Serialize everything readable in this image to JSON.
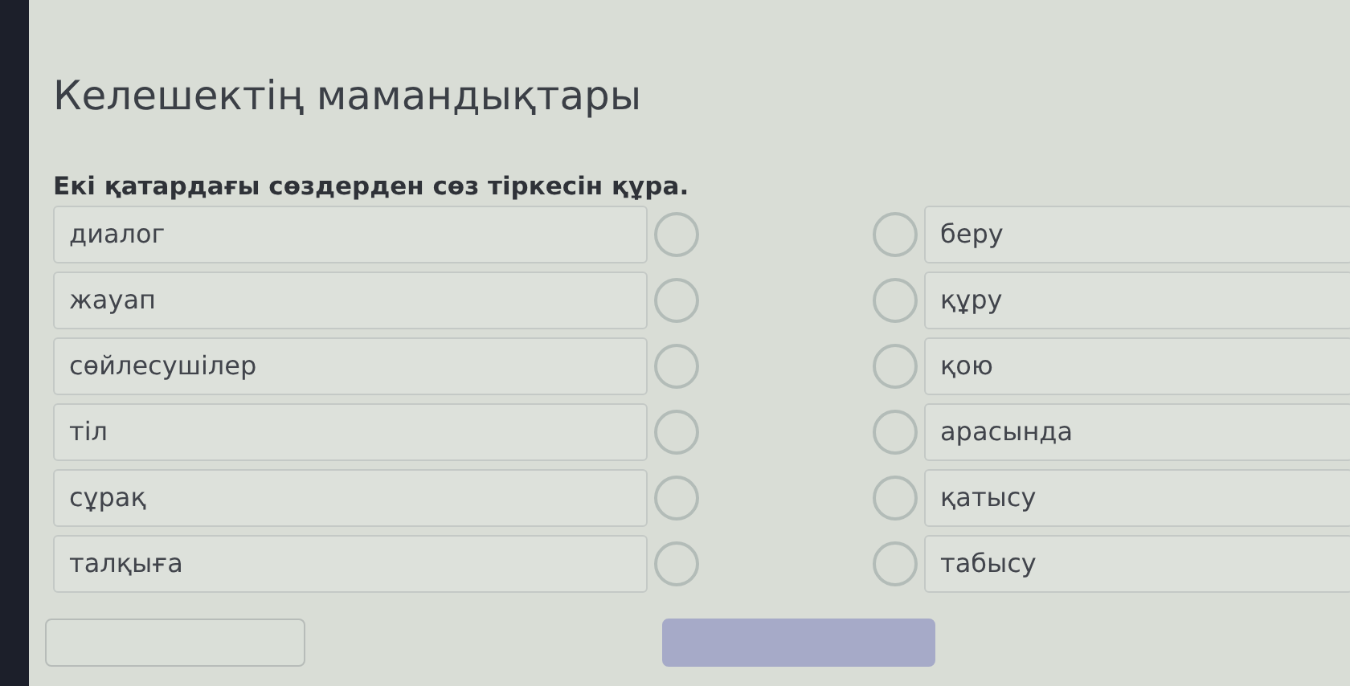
{
  "title": "Келешектің мамандықтары",
  "instruction": "Екі қатардағы сөздерден сөз тіркесін құра.",
  "left_items": [
    {
      "text": "диалог"
    },
    {
      "text": "жауап"
    },
    {
      "text": "сөйлесушілер"
    },
    {
      "text": "тіл"
    },
    {
      "text": "сұрақ"
    },
    {
      "text": "талқыға"
    }
  ],
  "right_items": [
    {
      "text": "беру"
    },
    {
      "text": "құру"
    },
    {
      "text": "қою"
    },
    {
      "text": "арасында"
    },
    {
      "text": "қатысу"
    },
    {
      "text": "табысу"
    }
  ],
  "buttons": [
    {
      "kind": "secondary"
    },
    {
      "kind": "primary"
    }
  ]
}
